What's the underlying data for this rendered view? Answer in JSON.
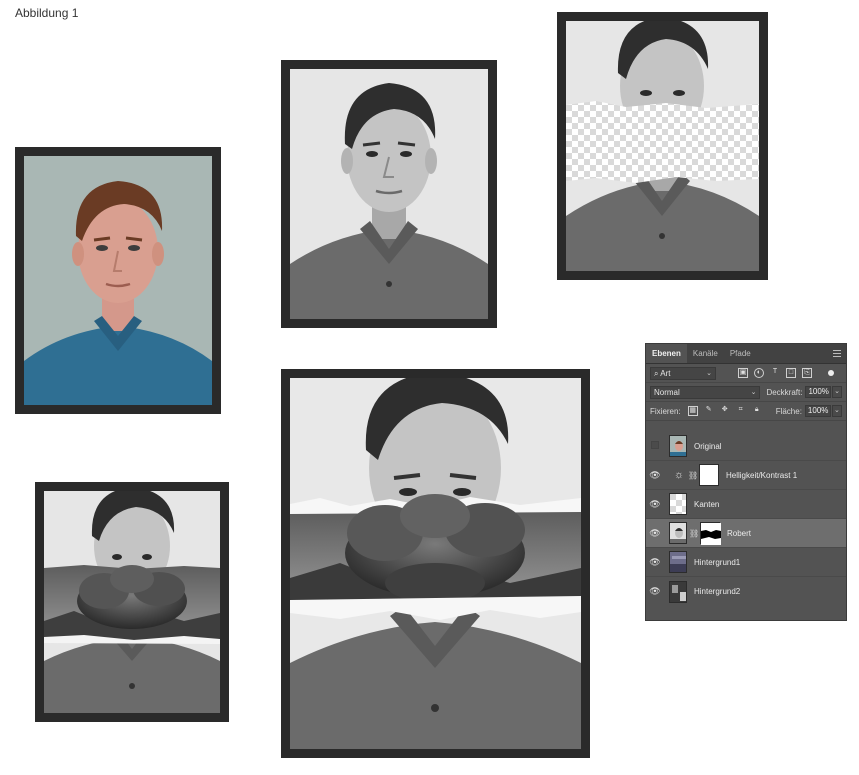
{
  "figure": {
    "caption": "Abbildung 1"
  },
  "layers_panel": {
    "tabs": [
      "Ebenen",
      "Kanäle",
      "Pfade"
    ],
    "filter_kind": "Art",
    "blend_mode": "Normal",
    "opacity_label": "Deckkraft:",
    "opacity_value": "100%",
    "lock_label": "Fixieren:",
    "fill_label": "Fläche:",
    "fill_value": "100%",
    "layers": [
      {
        "name": "Original",
        "visible": false
      },
      {
        "name": "Helligkeit/Kontrast 1",
        "visible": true
      },
      {
        "name": "Kanten",
        "visible": true
      },
      {
        "name": "Robert",
        "visible": true,
        "selected": true
      },
      {
        "name": "Hintergrund1",
        "visible": true
      },
      {
        "name": "Hintergrund2",
        "visible": true
      }
    ]
  },
  "colors": {
    "frame": "#2a2a2a",
    "panel_bg": "#535353",
    "panel_tab_bg": "#424242",
    "selected_layer": "#6e6e6e"
  }
}
